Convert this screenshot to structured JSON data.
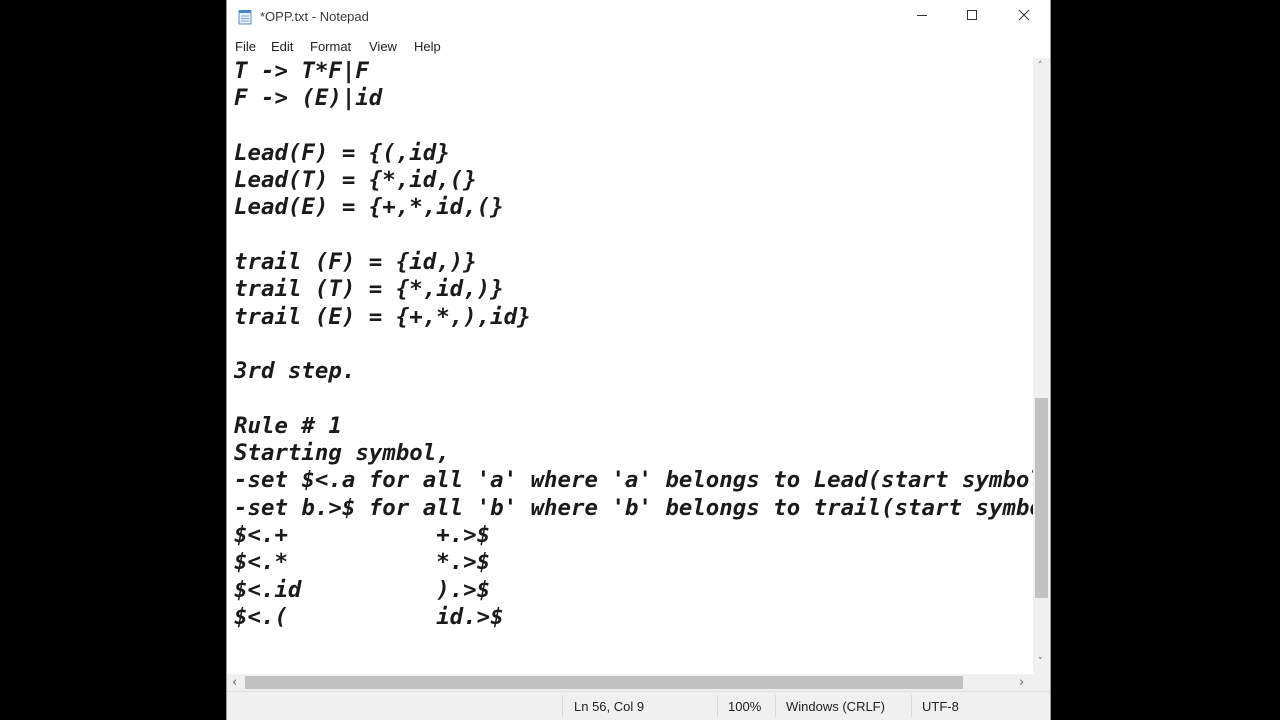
{
  "window": {
    "title": "*OPP.txt - Notepad",
    "app_icon": "notepad-icon",
    "controls": {
      "minimize_icon": "minimize-icon",
      "maximize_icon": "maximize-icon",
      "close_icon": "close-icon"
    }
  },
  "menu": {
    "items": [
      {
        "label": "File"
      },
      {
        "label": "Edit"
      },
      {
        "label": "Format"
      },
      {
        "label": "View"
      },
      {
        "label": "Help"
      }
    ]
  },
  "editor": {
    "content": "T -> T*F|F\nF -> (E)|id\n\nLead(F) = {(,id}\nLead(T) = {*,id,(}\nLead(E) = {+,*,id,(}\n\ntrail (F) = {id,)}\ntrail (T) = {*,id,)}\ntrail (E) = {+,*,),id}\n\n3rd step.\n\nRule # 1\nStarting symbol,\n-set $<.a for all 'a' where 'a' belongs to Lead(start symbol)\n-set b.>$ for all 'b' where 'b' belongs to trail(start symbol)\n$<.+           +.>$\n$<.*           *.>$\n$<.id          ).>$\n$<.(           id.>$"
  },
  "statusbar": {
    "position": "Ln 56, Col 9",
    "zoom": "100%",
    "line_ending": "Windows (CRLF)",
    "encoding": "UTF-8"
  },
  "scrollbars": {
    "up_arrow": "˄",
    "down_arrow": "˅",
    "left_arrow": "‹",
    "right_arrow": "›"
  }
}
